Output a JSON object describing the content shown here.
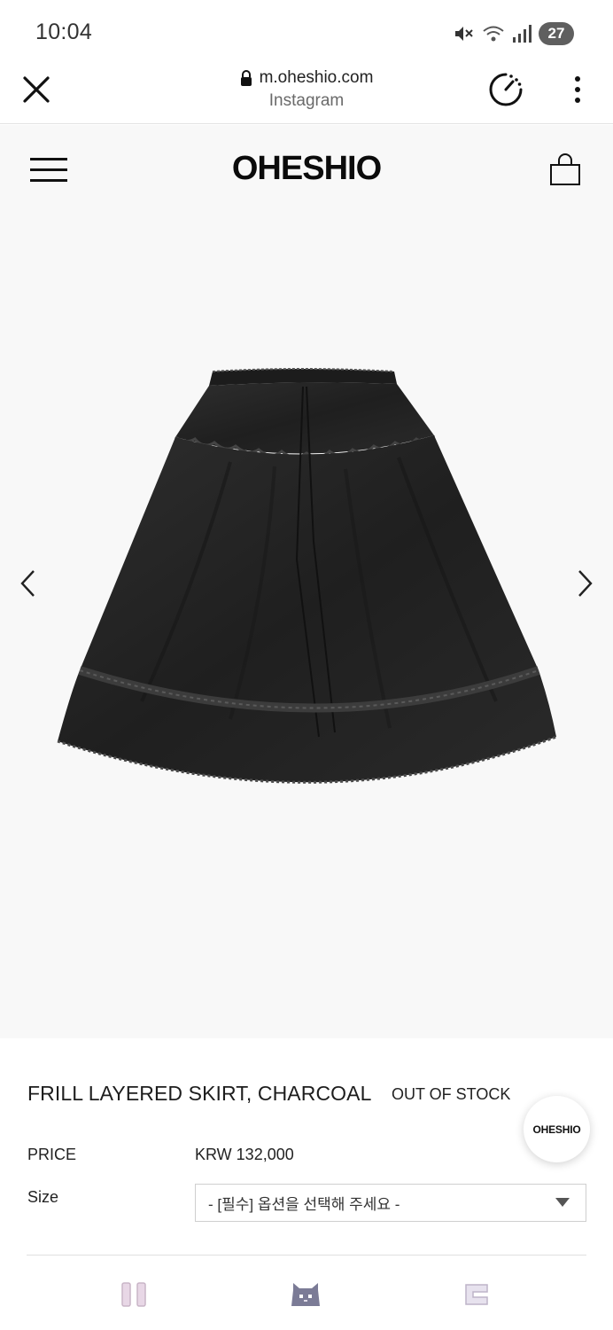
{
  "status_bar": {
    "time": "10:04",
    "icons": [
      "mute-icon",
      "wifi-icon",
      "signal-icon"
    ],
    "battery": "27"
  },
  "browser": {
    "url": "m.oheshio.com",
    "source": "Instagram",
    "icons": [
      "close-icon",
      "lock-icon",
      "speed-dial-icon",
      "more-vert-icon"
    ]
  },
  "site": {
    "logo": "OHESHIO",
    "icons": [
      "menu-icon",
      "shopping-bag-icon"
    ]
  },
  "gallery": {
    "icons": [
      "chevron-left-icon",
      "chevron-right-icon"
    ],
    "image": "charcoal-frill-skirt"
  },
  "product": {
    "title": "FRILL LAYERED SKIRT, CHARCOAL",
    "stock_status": "OUT OF STOCK",
    "price_label": "PRICE",
    "price_value": "KRW 132,000",
    "size_label": "Size",
    "size_placeholder": "- [필수] 옵션을 선택해 주세요 -",
    "brand_badge": "OHESHIO"
  },
  "colors": {
    "background": "#f8f8f8",
    "text": "#1a1a1a",
    "skirt": "#262626",
    "battery": "#5f5f5f"
  }
}
